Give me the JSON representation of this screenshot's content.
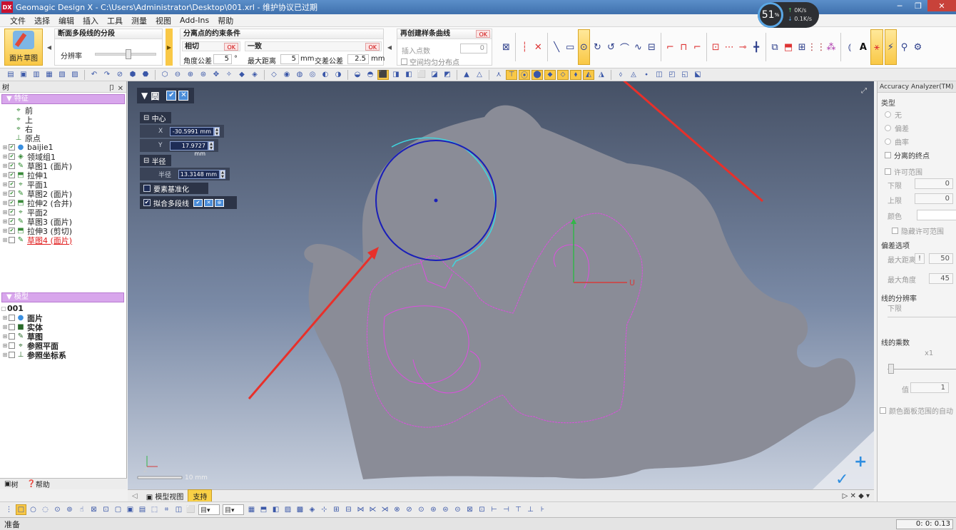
{
  "titlebar": {
    "logo": "DX",
    "title": "Geomagic Design X - C:\\Users\\Administrator\\Desktop\\001.xrl - 维护协议已过期"
  },
  "menu": [
    "文件",
    "选择",
    "编辑",
    "插入",
    "工具",
    "测量",
    "视图",
    "Add-Ins",
    "帮助"
  ],
  "netwidget": {
    "percent": "51",
    "percent_unit": "%",
    "up": "0K/s",
    "down": "0.1K/s"
  },
  "ribbon": {
    "mesh_sketch_label": "面片草图",
    "poly_group": {
      "title": "断面多段线的分段",
      "resolution_label": "分辨率",
      "slider_fraction": 0.55
    },
    "constraints_group": {
      "title": "分离点的约束条件",
      "tangent": {
        "title": "相切",
        "ok": "OK",
        "angle_label": "角度公差",
        "angle_value": "5",
        "angle_unit": "°"
      },
      "coincident": {
        "title": "一致",
        "ok": "OK",
        "maxdist_label": "最大距离",
        "maxdist_value": "5",
        "maxdist_unit": "mm",
        "cross_label": "交差公差",
        "cross_value": "2.5",
        "cross_unit": "mm"
      }
    },
    "spline_group": {
      "title": "再创建样条曲线",
      "ok": "OK",
      "insert_label": "插入点数",
      "insert_value": "0",
      "uniform_label": "空间均匀分布点"
    }
  },
  "icons": {
    "tools": [
      "⊠",
      "┆",
      "✕",
      "╲",
      "▭",
      "⊙",
      "↻",
      "↺",
      "⌒",
      "∿",
      "⊟",
      "⌐",
      "⊓",
      "⌐",
      "⊡",
      "⋯",
      "⊸",
      "╋",
      "⧉",
      "⬒",
      "⊞",
      "⋮⋮",
      "⁂",
      "⦅",
      "A",
      "⚹",
      "⚡",
      "⚲",
      "⚙"
    ],
    "toolbar2": [
      "▤",
      "▣",
      "▥",
      "▦",
      "▧",
      "▨",
      "↶",
      "↷",
      "⊘",
      "⬢",
      "⬣",
      "⬡",
      "⊖",
      "⊕",
      "⊛",
      "✥",
      "✧",
      "◆",
      "◈",
      "◇",
      "◉",
      "◍",
      "◎",
      "◐",
      "◑",
      "◒",
      "◓",
      "⬛",
      "◨",
      "◧",
      "⬜",
      "◪",
      "◩",
      "▲",
      "△",
      "⋏",
      "⊤",
      "⦿",
      "⬤",
      "⬥",
      "⬦",
      "⬧",
      "◭",
      "◮",
      "⬨",
      "◬",
      "⬩",
      "◫",
      "◰",
      "◱",
      "⬕"
    ],
    "bottom": [
      "⋮",
      "□",
      "○",
      "◌",
      "⊙",
      "⊚",
      "☝",
      "⊠",
      "⊡",
      "▢",
      "▣",
      "▤",
      "⬚",
      "⌗",
      "◫",
      "⬜",
      "▦",
      "⬒",
      "◧",
      "▨",
      "▩",
      "◈",
      "⊹",
      "⊞",
      "⊟",
      "⋈",
      "⋉",
      "⋊",
      "⊗",
      "⊘",
      "⊙",
      "⊛",
      "⊜",
      "⊝",
      "⊠",
      "⊡",
      "⊢",
      "⊣",
      "⊤",
      "⊥",
      "⊦"
    ]
  },
  "left_panel": {
    "header": "树",
    "header_controls": "卩 ✕",
    "features_title": "特征",
    "features": [
      {
        "label": "前",
        "icon": "⌖",
        "indent": 1,
        "exp": "",
        "chk": false
      },
      {
        "label": "上",
        "icon": "⌖",
        "indent": 1,
        "exp": "",
        "chk": false
      },
      {
        "label": "右",
        "icon": "⌖",
        "indent": 1,
        "exp": "",
        "chk": false
      },
      {
        "label": "原点",
        "icon": "⊥",
        "indent": 1,
        "exp": "",
        "chk": false
      },
      {
        "label": "baijie1",
        "icon": "●",
        "indent": 0,
        "exp": "⊞",
        "chk": true
      },
      {
        "label": "领域组1",
        "icon": "◈",
        "indent": 0,
        "exp": "⊞",
        "chk": true
      },
      {
        "label": "草图1 (面片)",
        "icon": "✎",
        "indent": 0,
        "exp": "⊞",
        "chk": true
      },
      {
        "label": "拉伸1",
        "icon": "⬒",
        "indent": 0,
        "exp": "⊞",
        "chk": true
      },
      {
        "label": "平面1",
        "icon": "⌖",
        "indent": 0,
        "exp": "⊞",
        "chk": true
      },
      {
        "label": "草图2 (面片)",
        "icon": "✎",
        "indent": 0,
        "exp": "⊞",
        "chk": true
      },
      {
        "label": "拉伸2 (合并)",
        "icon": "⬒",
        "indent": 0,
        "exp": "⊞",
        "chk": true
      },
      {
        "label": "平面2",
        "icon": "⌖",
        "indent": 0,
        "exp": "⊞",
        "chk": true
      },
      {
        "label": "草图3 (面片)",
        "icon": "✎",
        "indent": 0,
        "exp": "⊞",
        "chk": true
      },
      {
        "label": "拉伸3 (剪切)",
        "icon": "⬒",
        "indent": 0,
        "exp": "⊞",
        "chk": true
      },
      {
        "label": "草图4 (面片)",
        "icon": "✎",
        "indent": 0,
        "exp": "⊞",
        "chk": false,
        "red": true
      }
    ],
    "model_title": "模型",
    "model_root": "001",
    "model_items": [
      {
        "label": "面片",
        "icon": "●"
      },
      {
        "label": "实体",
        "icon": "■"
      },
      {
        "label": "草图",
        "icon": "✎"
      },
      {
        "label": "参照平面",
        "icon": "⌖"
      },
      {
        "label": "参照坐标系",
        "icon": "⊥"
      }
    ],
    "tabs": [
      "树",
      "帮助"
    ]
  },
  "circle_dialog": {
    "title": "圆",
    "center_label": "中心",
    "x_label": "X",
    "x_value": "-30.5991 mm",
    "y_label": "Y",
    "y_value": "17.9727 mm",
    "radius_section": "半径",
    "radius_label": "半径",
    "radius_value": "13.3148 mm",
    "option1": "要素基准化",
    "option2": "拟合多段线"
  },
  "viewport": {
    "axis_label_u": "U",
    "scale_label": "10 mm",
    "triad_z": "Z",
    "colors": {
      "body": "#8a8c97",
      "sketch": "#dd4ee0",
      "circle": "#1a1fb8",
      "arrow": "#e8302a",
      "yaxis": "#35b54a",
      "xaxis": "#d43c3c"
    }
  },
  "view_tabs": [
    "模型视图",
    "支持"
  ],
  "right_panel": {
    "title": "Accuracy Analyzer(TM)",
    "type_title": "类型",
    "types": [
      "无",
      "偏差",
      "曲率"
    ],
    "separate_endpoints": "分离的终点",
    "tolerance_title": "许可范围",
    "lower_label": "下限",
    "lower_value": "0",
    "upper_label": "上限",
    "upper_value": "0",
    "color_label": "颜色",
    "hide_tolerance": "隐藏许可范围",
    "deviation_title": "偏差选项",
    "maxdist_label": "最大距离",
    "maxdist_value": "50",
    "maxangle_label": "最大角度",
    "maxangle_value": "45",
    "resolution_title": "线的分辨率",
    "resolution_lower": "下限",
    "multiplier_title": "线的乘数",
    "multiplier_value_label": "x1",
    "value_label": "值",
    "value_value": "1",
    "auto_range": "颜色面板范围的自动"
  },
  "bottom": {
    "select1": "目▾",
    "select2": "目▾"
  },
  "status": {
    "text": "准备",
    "time": "0: 0: 0.13"
  }
}
